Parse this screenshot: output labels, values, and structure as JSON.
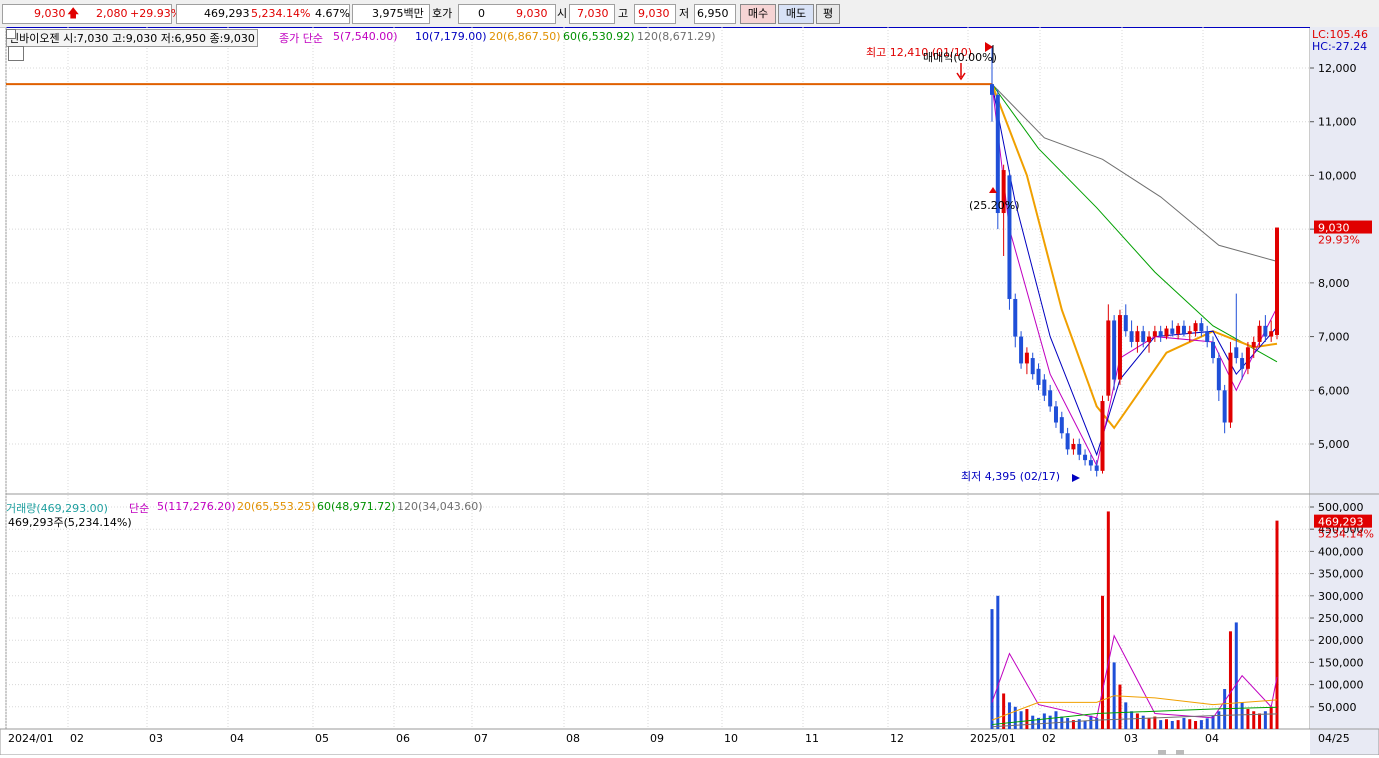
{
  "topbar": {
    "price": "9,030",
    "change": "2,080",
    "change_pct": "+29.93%",
    "volume": "469,293",
    "volume_pct": "5,234.14%",
    "turnover_pct": "4.67%",
    "amount": "3,975백만",
    "hoga_label": "호가",
    "hoga_value": "0",
    "hoga_price": "9,030",
    "open_label": "시",
    "open": "7,030",
    "high_label": "고",
    "high": "9,030",
    "low_label": "저",
    "low": "6,950",
    "buy_label": "매수",
    "sell_label": "매도",
    "eval_label": "평"
  },
  "price_legend": {
    "stock": "인바이오젠 시:7,030 고:9,030 저:6,950 종:9,030",
    "ma_prefix": "종가 단순",
    "ma5": "5(7,540.00)",
    "ma10": "10(7,179.00)",
    "ma20": "20(6,867.50)",
    "ma60": "60(6,530.92)",
    "ma120": "120(8,671.29)"
  },
  "volume_legend": {
    "vol": "거래량(469,293.00)",
    "ma_prefix": "단순",
    "ma5": "5(117,276.20)",
    "ma20": "20(65,553.25)",
    "ma60": "60(48,971.72)",
    "ma120": "120(34,043.60)",
    "sub": "469,293주(5,234.14%)"
  },
  "lc": "LC:105.46",
  "hc": "HC:-27.24",
  "annotations": {
    "high": "최고 12,410 (01/10)",
    "maemae": "매매익(0.00%)",
    "pct": "(25.20%)",
    "low": "최저 4,395 (02/17)"
  },
  "price_axis": {
    "ticks": [
      "12,000",
      "11,000",
      "10,000",
      "9,000",
      "8,000",
      "7,000",
      "6,000",
      "5,000"
    ],
    "current": "9,030",
    "current_pct": "29.93%"
  },
  "volume_axis": {
    "ticks": [
      "500,000",
      "450,000",
      "400,000",
      "350,000",
      "300,000",
      "250,000",
      "200,000",
      "150,000",
      "100,000",
      "50,000"
    ],
    "current": "469,293",
    "current_pct": "5234.14%"
  },
  "x_axis": {
    "ticks": [
      "2024/01",
      "02",
      "03",
      "04",
      "05",
      "06",
      "07",
      "08",
      "09",
      "10",
      "11",
      "12",
      "2025/01",
      "02",
      "03",
      "04"
    ],
    "end_label": "04/25"
  },
  "colors": {
    "up": "#e00000",
    "down": "#1f4fd8",
    "ma5": "#c000c0",
    "ma10": "#0000c0",
    "ma20": "#f0a000",
    "ma60": "#00a000",
    "ma120": "#707070",
    "hline": "#e06000"
  },
  "chart_data": {
    "type": "candlestick",
    "x_range": [
      "2024/01",
      "2025/04/25"
    ],
    "ylim_price": [
      4300,
      12900
    ],
    "ylim_volume": [
      0,
      510000
    ],
    "hline": 11700,
    "candles": [
      {
        "o": 11700,
        "h": 12410,
        "l": 11000,
        "c": 11500
      },
      {
        "o": 11500,
        "h": 11600,
        "l": 9000,
        "c": 9300
      },
      {
        "o": 9300,
        "h": 10200,
        "l": 8500,
        "c": 10100
      },
      {
        "o": 10000,
        "h": 10100,
        "l": 7500,
        "c": 7700
      },
      {
        "o": 7700,
        "h": 7800,
        "l": 6800,
        "c": 7000
      },
      {
        "o": 7000,
        "h": 7100,
        "l": 6400,
        "c": 6500
      },
      {
        "o": 6500,
        "h": 6800,
        "l": 6300,
        "c": 6700
      },
      {
        "o": 6600,
        "h": 6700,
        "l": 6200,
        "c": 6300
      },
      {
        "o": 6400,
        "h": 6500,
        "l": 6000,
        "c": 6100
      },
      {
        "o": 6200,
        "h": 6300,
        "l": 5800,
        "c": 5900
      },
      {
        "o": 6000,
        "h": 6100,
        "l": 5600,
        "c": 5700
      },
      {
        "o": 5700,
        "h": 5800,
        "l": 5300,
        "c": 5400
      },
      {
        "o": 5500,
        "h": 5600,
        "l": 5100,
        "c": 5200
      },
      {
        "o": 5200,
        "h": 5300,
        "l": 4800,
        "c": 4900
      },
      {
        "o": 4900,
        "h": 5100,
        "l": 4800,
        "c": 5000
      },
      {
        "o": 5000,
        "h": 5100,
        "l": 4700,
        "c": 4800
      },
      {
        "o": 4800,
        "h": 4900,
        "l": 4600,
        "c": 4700
      },
      {
        "o": 4700,
        "h": 4800,
        "l": 4500,
        "c": 4600
      },
      {
        "o": 4600,
        "h": 4700,
        "l": 4395,
        "c": 4500
      },
      {
        "o": 4500,
        "h": 5900,
        "l": 4450,
        "c": 5800
      },
      {
        "o": 5900,
        "h": 7600,
        "l": 5800,
        "c": 7300
      },
      {
        "o": 7300,
        "h": 7400,
        "l": 6000,
        "c": 6200
      },
      {
        "o": 6200,
        "h": 7500,
        "l": 6100,
        "c": 7400
      },
      {
        "o": 7400,
        "h": 7600,
        "l": 7000,
        "c": 7100
      },
      {
        "o": 7100,
        "h": 7300,
        "l": 6800,
        "c": 6900
      },
      {
        "o": 6900,
        "h": 7200,
        "l": 6700,
        "c": 7100
      },
      {
        "o": 7100,
        "h": 7200,
        "l": 6800,
        "c": 6900
      },
      {
        "o": 6900,
        "h": 7100,
        "l": 6700,
        "c": 7000
      },
      {
        "o": 7000,
        "h": 7200,
        "l": 6900,
        "c": 7100
      },
      {
        "o": 7100,
        "h": 7200,
        "l": 6900,
        "c": 7000
      },
      {
        "o": 7000,
        "h": 7200,
        "l": 6950,
        "c": 7150
      },
      {
        "o": 7150,
        "h": 7300,
        "l": 7000,
        "c": 7050
      },
      {
        "o": 7050,
        "h": 7250,
        "l": 6950,
        "c": 7200
      },
      {
        "o": 7200,
        "h": 7300,
        "l": 7000,
        "c": 7050
      },
      {
        "o": 7050,
        "h": 7200,
        "l": 6900,
        "c": 7100
      },
      {
        "o": 7100,
        "h": 7300,
        "l": 7000,
        "c": 7250
      },
      {
        "o": 7250,
        "h": 7350,
        "l": 7000,
        "c": 7100
      },
      {
        "o": 7100,
        "h": 7200,
        "l": 6800,
        "c": 6900
      },
      {
        "o": 6900,
        "h": 7000,
        "l": 6500,
        "c": 6600
      },
      {
        "o": 6600,
        "h": 6700,
        "l": 5800,
        "c": 6000
      },
      {
        "o": 6000,
        "h": 6100,
        "l": 5200,
        "c": 5400
      },
      {
        "o": 5400,
        "h": 6900,
        "l": 5300,
        "c": 6700
      },
      {
        "o": 6800,
        "h": 7800,
        "l": 6500,
        "c": 6600
      },
      {
        "o": 6600,
        "h": 6700,
        "l": 6200,
        "c": 6400
      },
      {
        "o": 6400,
        "h": 6900,
        "l": 6300,
        "c": 6800
      },
      {
        "o": 6800,
        "h": 7000,
        "l": 6600,
        "c": 6900
      },
      {
        "o": 6900,
        "h": 7300,
        "l": 6800,
        "c": 7200
      },
      {
        "o": 7200,
        "h": 7400,
        "l": 6900,
        "c": 7000
      },
      {
        "o": 7000,
        "h": 7300,
        "l": 6900,
        "c": 7100
      },
      {
        "o": 7030,
        "h": 9030,
        "l": 6950,
        "c": 9030
      }
    ],
    "volumes": [
      270000,
      300000,
      80000,
      60000,
      50000,
      40000,
      45000,
      30000,
      25000,
      35000,
      30000,
      40000,
      28000,
      25000,
      20000,
      22000,
      18000,
      30000,
      25000,
      300000,
      490000,
      150000,
      100000,
      60000,
      40000,
      35000,
      30000,
      25000,
      28000,
      20000,
      22000,
      18000,
      20000,
      25000,
      22000,
      18000,
      20000,
      24000,
      30000,
      40000,
      90000,
      220000,
      240000,
      60000,
      45000,
      40000,
      35000,
      40000,
      50000,
      469293
    ],
    "ma": {
      "ma120": [
        [
          0,
          11700
        ],
        [
          9,
          10700
        ],
        [
          19,
          10300
        ],
        [
          29,
          9600
        ],
        [
          39,
          8700
        ],
        [
          49,
          8400
        ]
      ],
      "ma60": [
        [
          0,
          11700
        ],
        [
          8,
          10500
        ],
        [
          18,
          9400
        ],
        [
          28,
          8200
        ],
        [
          38,
          7200
        ],
        [
          49,
          6530
        ]
      ],
      "ma20": [
        [
          0,
          11700
        ],
        [
          6,
          10000
        ],
        [
          12,
          7500
        ],
        [
          18,
          5700
        ],
        [
          21,
          5300
        ],
        [
          30,
          6700
        ],
        [
          38,
          7100
        ],
        [
          45,
          6800
        ],
        [
          49,
          6867
        ]
      ],
      "ma10": [
        [
          0,
          11700
        ],
        [
          4,
          9500
        ],
        [
          10,
          7000
        ],
        [
          18,
          4800
        ],
        [
          22,
          6200
        ],
        [
          28,
          7000
        ],
        [
          38,
          7100
        ],
        [
          42,
          6300
        ],
        [
          49,
          7179
        ]
      ],
      "ma5": [
        [
          0,
          11700
        ],
        [
          3,
          9000
        ],
        [
          10,
          6300
        ],
        [
          18,
          4600
        ],
        [
          22,
          6600
        ],
        [
          28,
          7000
        ],
        [
          38,
          6900
        ],
        [
          42,
          6000
        ],
        [
          46,
          6900
        ],
        [
          49,
          7540
        ]
      ]
    },
    "vol_ma": {
      "ma5": [
        [
          0,
          60000
        ],
        [
          3,
          170000
        ],
        [
          8,
          55000
        ],
        [
          18,
          25000
        ],
        [
          21,
          210000
        ],
        [
          28,
          35000
        ],
        [
          38,
          25000
        ],
        [
          43,
          120000
        ],
        [
          48,
          50000
        ],
        [
          49,
          117276
        ]
      ],
      "ma20": [
        [
          0,
          20000
        ],
        [
          8,
          60000
        ],
        [
          18,
          60000
        ],
        [
          21,
          75000
        ],
        [
          28,
          70000
        ],
        [
          38,
          55000
        ],
        [
          49,
          65553
        ]
      ],
      "ma60": [
        [
          0,
          10000
        ],
        [
          18,
          35000
        ],
        [
          38,
          45000
        ],
        [
          49,
          48971
        ]
      ],
      "ma120": [
        [
          0,
          5000
        ],
        [
          18,
          20000
        ],
        [
          38,
          30000
        ],
        [
          49,
          34043
        ]
      ]
    }
  }
}
